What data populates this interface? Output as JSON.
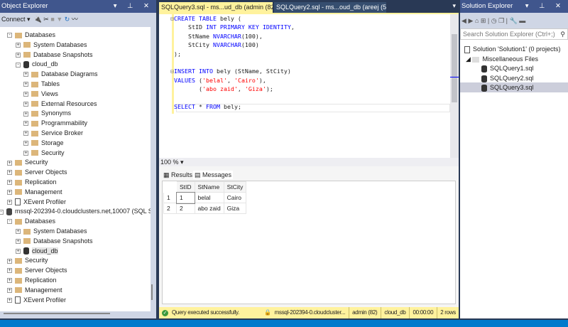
{
  "object_explorer": {
    "title": "Object Explorer",
    "connect_label": "Connect",
    "tree": [
      {
        "label": "Databases",
        "level": 1,
        "icon": "folder",
        "exp": "-"
      },
      {
        "label": "System Databases",
        "level": 2,
        "icon": "folder",
        "exp": "+"
      },
      {
        "label": "Database Snapshots",
        "level": 2,
        "icon": "folder",
        "exp": "+"
      },
      {
        "label": "cloud_db",
        "level": 2,
        "icon": "database",
        "exp": "-"
      },
      {
        "label": "Database Diagrams",
        "level": 3,
        "icon": "folder",
        "exp": "+"
      },
      {
        "label": "Tables",
        "level": 3,
        "icon": "folder",
        "exp": "+"
      },
      {
        "label": "Views",
        "level": 3,
        "icon": "folder",
        "exp": "+"
      },
      {
        "label": "External Resources",
        "level": 3,
        "icon": "folder",
        "exp": "+"
      },
      {
        "label": "Synonyms",
        "level": 3,
        "icon": "folder",
        "exp": "+"
      },
      {
        "label": "Programmability",
        "level": 3,
        "icon": "folder",
        "exp": "+"
      },
      {
        "label": "Service Broker",
        "level": 3,
        "icon": "folder",
        "exp": "+"
      },
      {
        "label": "Storage",
        "level": 3,
        "icon": "folder",
        "exp": "+"
      },
      {
        "label": "Security",
        "level": 3,
        "icon": "folder",
        "exp": "+"
      },
      {
        "label": "Security",
        "level": 1,
        "icon": "folder",
        "exp": "+"
      },
      {
        "label": "Server Objects",
        "level": 1,
        "icon": "folder",
        "exp": "+"
      },
      {
        "label": "Replication",
        "level": 1,
        "icon": "folder",
        "exp": "+"
      },
      {
        "label": "Management",
        "level": 1,
        "icon": "folder",
        "exp": "+"
      },
      {
        "label": "XEvent Profiler",
        "level": 1,
        "icon": "xevent",
        "exp": "+"
      },
      {
        "label": "mssql-202394-0.cloudclusters.net,10007 (SQL Server 16.0.4015",
        "level": 0,
        "icon": "server",
        "exp": "-"
      },
      {
        "label": "Databases",
        "level": 1,
        "icon": "folder",
        "exp": "-"
      },
      {
        "label": "System Databases",
        "level": 2,
        "icon": "folder",
        "exp": "+"
      },
      {
        "label": "Database Snapshots",
        "level": 2,
        "icon": "folder",
        "exp": "+"
      },
      {
        "label": "cloud_db",
        "level": 2,
        "icon": "database",
        "exp": "+",
        "selected": true
      },
      {
        "label": "Security",
        "level": 1,
        "icon": "folder",
        "exp": "+"
      },
      {
        "label": "Server Objects",
        "level": 1,
        "icon": "folder",
        "exp": "+"
      },
      {
        "label": "Replication",
        "level": 1,
        "icon": "folder",
        "exp": "+"
      },
      {
        "label": "Management",
        "level": 1,
        "icon": "folder",
        "exp": "+"
      },
      {
        "label": "XEvent Profiler",
        "level": 1,
        "icon": "xevent",
        "exp": "+"
      }
    ]
  },
  "editor": {
    "tabs": [
      {
        "label": "SQLQuery3.sql - ms...ud_db (admin (82))*",
        "active": true
      },
      {
        "label": "SQLQuery2.sql - ms...oud_db (areej (55))*",
        "active": false
      }
    ],
    "code_lines": [
      "<span class='gr'>⊟</span><span class='kw'>CREATE TABLE</span> bely (",
      "     StID <span class='kw'>INT PRIMARY KEY IDENTITY</span>,",
      "     StName <span class='kw'>NVARCHAR</span>(100),",
      "     StCity <span class='kw'>NVARCHAR</span>(100)",
      " );",
      "",
      "<span class='gr'>⊟</span><span class='kw'>INSERT INTO</span> bely (StName, StCity)",
      " <span class='kw'>VALUES</span> (<span class='str'>'belal'</span>, <span class='str'>'Cairo'</span>),",
      "        (<span class='str'>'abo zaid'</span>, <span class='str'>'Giza'</span>);",
      "",
      " <span class='kw'>SELECT</span> * <span class='kw'>FROM</span> bely;"
    ],
    "zoom": "100 %",
    "results_tabs": [
      "Results",
      "Messages"
    ],
    "grid": {
      "columns": [
        "StID",
        "StName",
        "StCity"
      ],
      "rows": [
        [
          "1",
          "1",
          "belal",
          "Cairo"
        ],
        [
          "2",
          "2",
          "abo zaid",
          "Giza"
        ]
      ]
    },
    "status": {
      "message": "Query executed successfully.",
      "server": "mssql-202394-0.cloudcluster...",
      "user": "admin (82)",
      "database": "cloud_db",
      "time": "00:00:00",
      "rows": "2 rows"
    }
  },
  "solution_explorer": {
    "title": "Solution Explorer",
    "search_placeholder": "Search Solution Explorer (Ctrl+;)",
    "solution": "Solution 'Solution1' (0 projects)",
    "folder": "Miscellaneous Files",
    "files": [
      "SQLQuery1.sql",
      "SQLQuery2.sql",
      "SQLQuery3.sql"
    ]
  }
}
